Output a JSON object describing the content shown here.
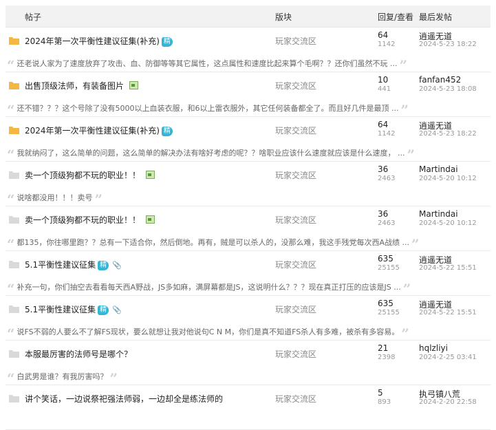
{
  "header": {
    "col_title": "帖子",
    "col_forum": "版块",
    "col_stats": "回复/查看",
    "col_last": "最后发帖"
  },
  "threads": [
    {
      "title": "2024年第一次平衡性建议征集(补充)",
      "folder": "yellow",
      "badge": "精",
      "has_image": false,
      "has_attachment": false,
      "forum": "玩家交流区",
      "replies": "64",
      "views": "1142",
      "author": "逍遥无道",
      "time": "2024-5-23 18:22",
      "excerpt": "还老说人家为了速度放弃了攻击、血、防御等等其它属性，这点属性和速度比起来算个毛啊？？还你们虽然不玩 ..."
    },
    {
      "title": "出售顶级法师，有装备图片",
      "folder": "yellow",
      "badge": "",
      "has_image": true,
      "has_attachment": false,
      "forum": "玩家交流区",
      "replies": "10",
      "views": "441",
      "author": "fanfan452",
      "time": "2024-5-23 18:08",
      "excerpt": "还不错？？？这个号除了没有5000以上血装衣服，和6以上雷衣服外，其它任何装备都全了。而且好几件是最顶 ..."
    },
    {
      "title": "2024年第一次平衡性建议征集(补充)",
      "folder": "yellow",
      "badge": "精",
      "has_image": false,
      "has_attachment": false,
      "forum": "玩家交流区",
      "replies": "64",
      "views": "1142",
      "author": "逍遥无道",
      "time": "2024-5-23 18:22",
      "excerpt": "我就纳闷了，这么简单的问题，这么简单的解决办法有啥好考虑的呢？？啥职业应该什么速度就应该是什么速度， ..."
    },
    {
      "title": "卖一个顶级狗都不玩的职业！！",
      "folder": "gray",
      "badge": "",
      "has_image": true,
      "has_attachment": false,
      "forum": "玩家交流区",
      "replies": "36",
      "views": "2463",
      "author": "Martindai",
      "time": "2024-5-20 10:12",
      "excerpt": "说啥都没用！！！卖号"
    },
    {
      "title": "卖一个顶级狗都不玩的职业！！",
      "folder": "gray",
      "badge": "",
      "has_image": true,
      "has_attachment": false,
      "forum": "玩家交流区",
      "replies": "36",
      "views": "2463",
      "author": "Martindai",
      "time": "2024-5-20 10:12",
      "excerpt": "都135，你往哪里跑？？总有一下适合你，然后倒地。再有，贼是可以杀人的，没那么难，我这手残党每次西A战绩 ..."
    },
    {
      "title": "5.1平衡性建议征集",
      "folder": "gray",
      "badge": "精",
      "has_image": false,
      "has_attachment": true,
      "forum": "玩家交流区",
      "replies": "635",
      "views": "25155",
      "author": "逍遥无道",
      "time": "2024-5-22 15:51",
      "excerpt": "补充一句，你们抽空去看看每天西A野战，JS多如麻，满屏幕都是JS，这说明什么？？？现在真正打压的应该是JS ..."
    },
    {
      "title": "5.1平衡性建议征集",
      "folder": "gray",
      "badge": "精",
      "has_image": false,
      "has_attachment": true,
      "forum": "玩家交流区",
      "replies": "635",
      "views": "25155",
      "author": "逍遥无道",
      "time": "2024-5-22 15:51",
      "excerpt": "说FS不弱的人要么不了解FS现状，要么就想让我对他说句C N M，你们是真不知道FS杀人有多难，被杀有多容易。"
    },
    {
      "title": "本服最厉害的法师号是哪个？",
      "folder": "gray",
      "badge": "",
      "has_image": false,
      "has_attachment": false,
      "forum": "玩家交流区",
      "replies": "21",
      "views": "2398",
      "author": "hqlzliyi",
      "time": "2024-2-25 03:41",
      "excerpt": "白武男是谁？有我厉害吗？"
    },
    {
      "title": "讲个笑话，一边说祭祀强法师弱，一边却全是练法师的",
      "folder": "gray",
      "badge": "",
      "has_image": false,
      "has_attachment": false,
      "forum": "玩家交流区",
      "replies": "5",
      "views": "893",
      "author": "执弓镇八荒",
      "time": "2024-2-20 22:58",
      "excerpt": ""
    }
  ],
  "colors": {
    "folder_yellow": "#f5b741",
    "folder_gray": "#d9d9d9",
    "badge": "#35b5d6"
  }
}
